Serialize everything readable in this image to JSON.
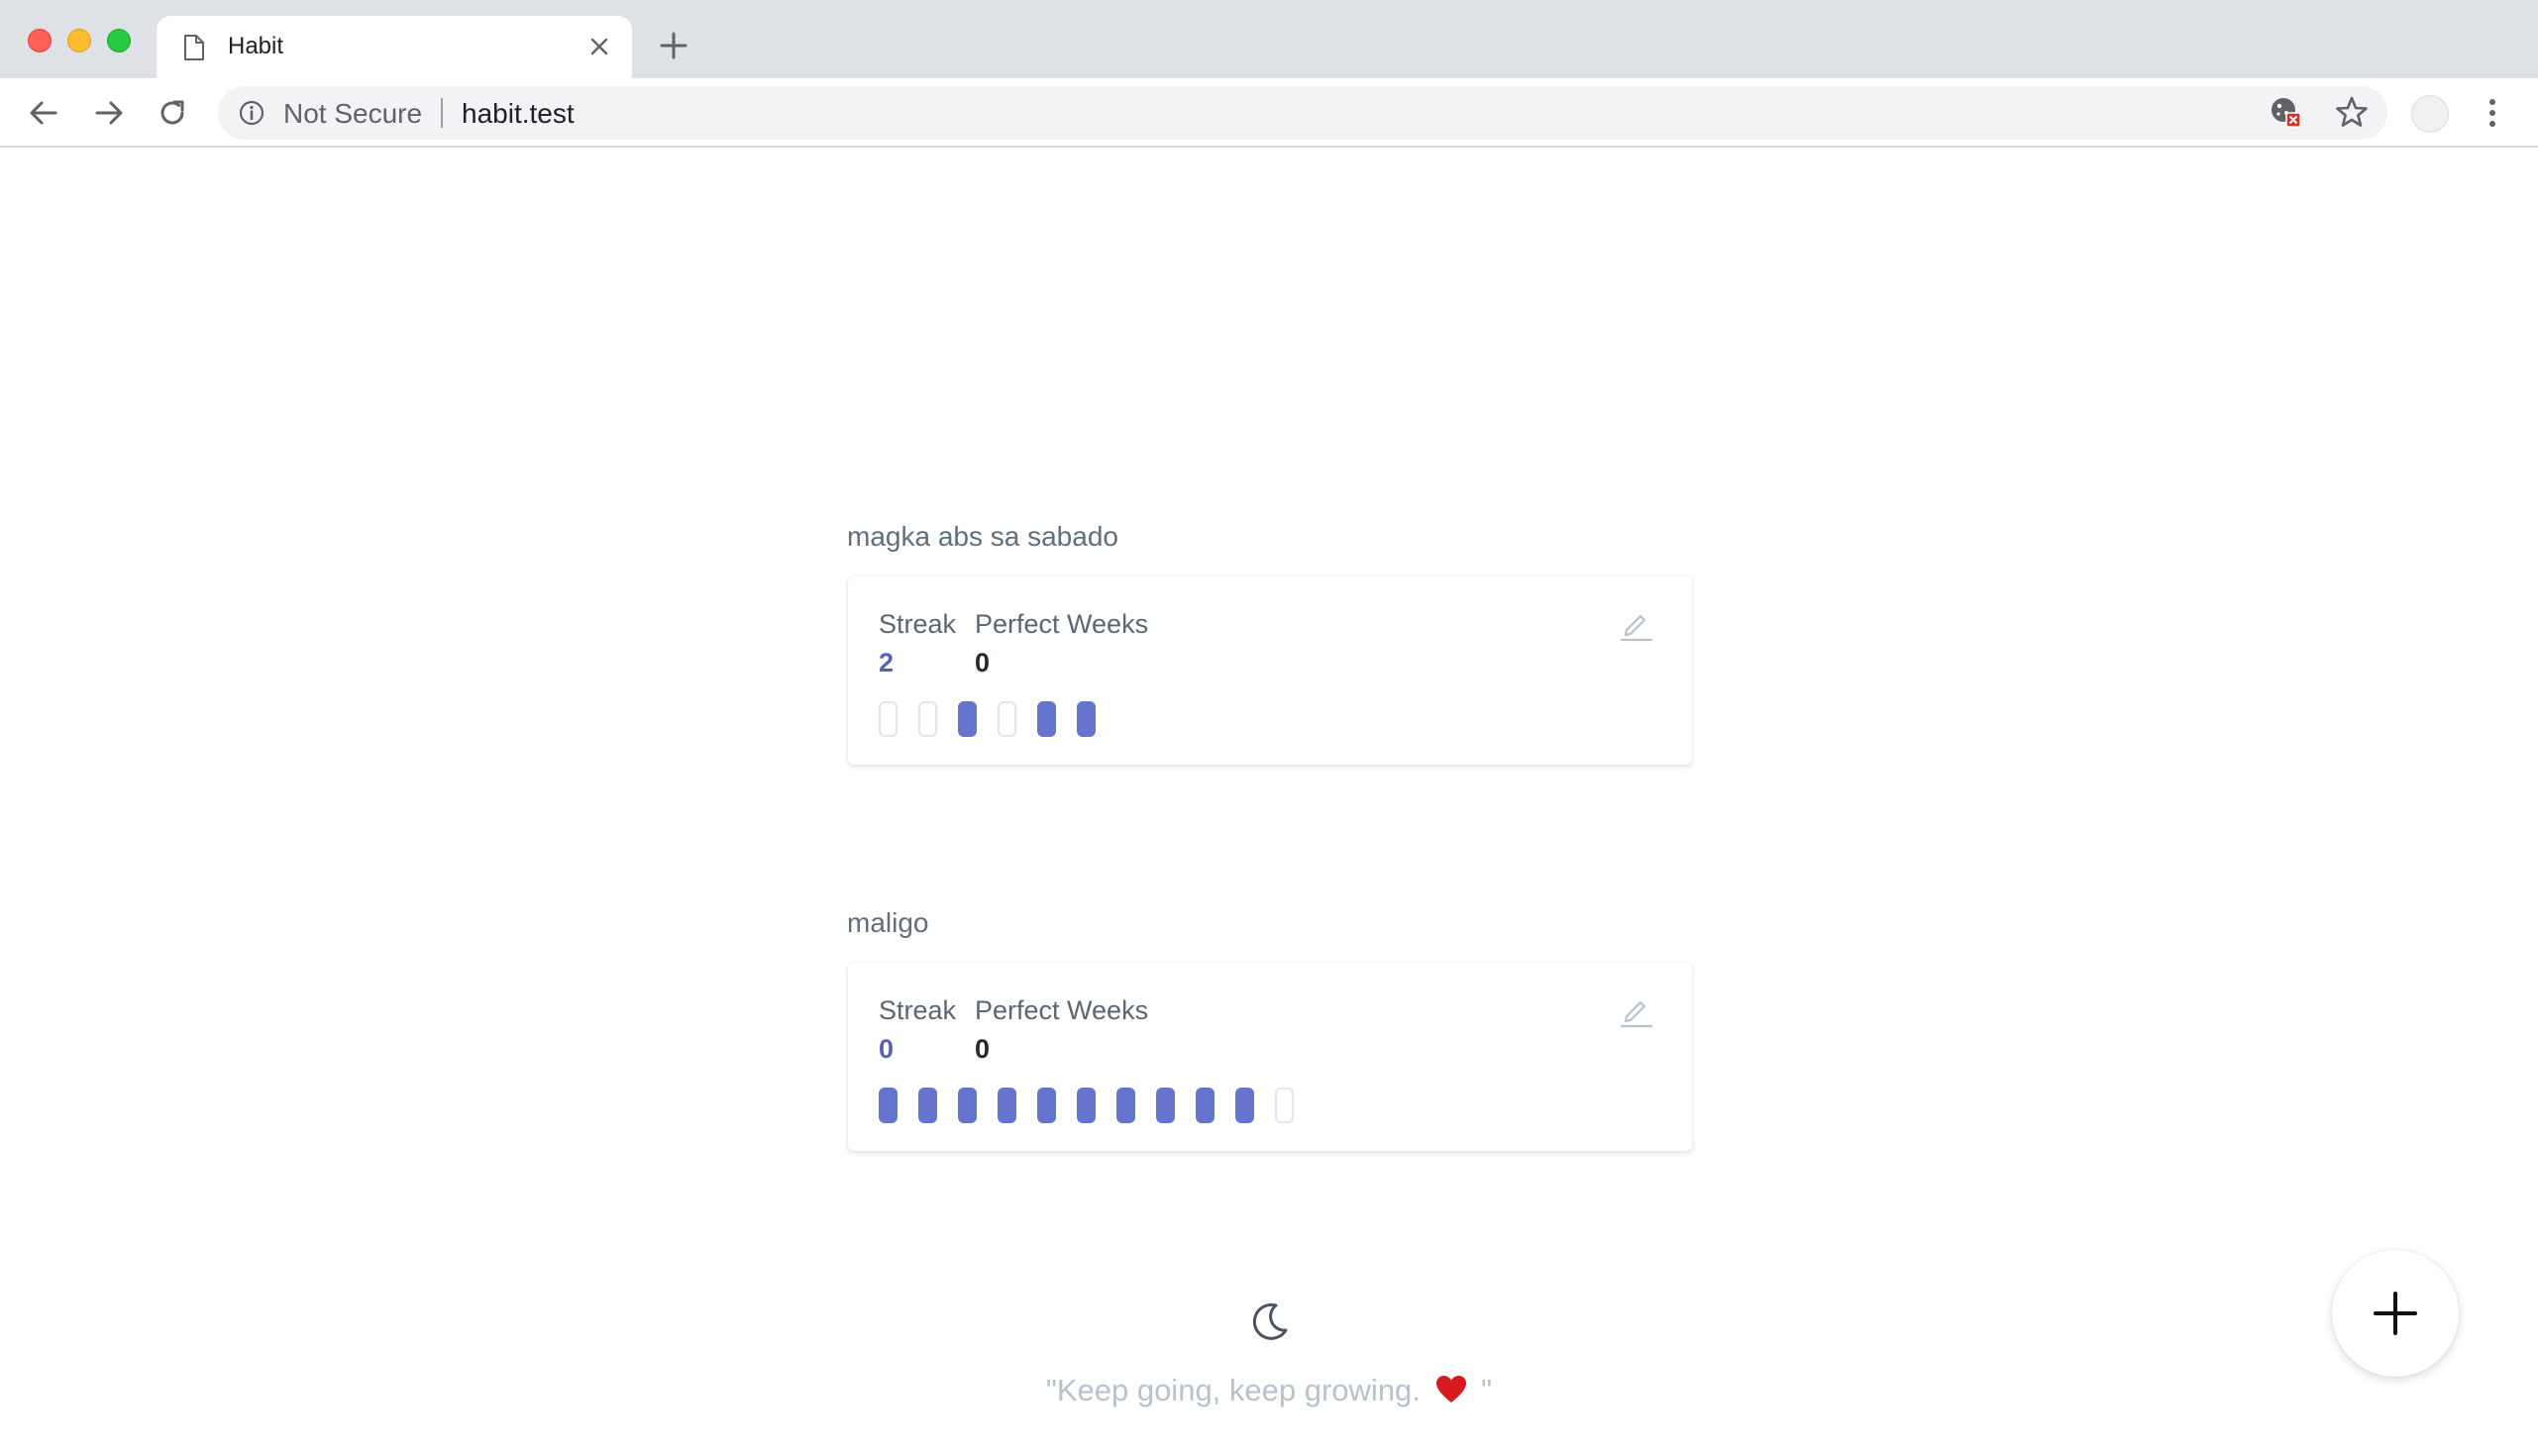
{
  "browser": {
    "tab_title": "Habit",
    "security_label": "Not Secure",
    "url": "habit.test"
  },
  "habits": [
    {
      "name": "magka abs sa sabado",
      "streak_label": "Streak",
      "streak_value": "2",
      "perfect_weeks_label": "Perfect Weeks",
      "perfect_weeks_value": "0",
      "days": [
        false,
        false,
        true,
        false,
        true,
        true
      ]
    },
    {
      "name": "maligo",
      "streak_label": "Streak",
      "streak_value": "0",
      "perfect_weeks_label": "Perfect Weeks",
      "perfect_weeks_value": "0",
      "days": [
        true,
        true,
        true,
        true,
        true,
        true,
        true,
        true,
        true,
        true,
        false
      ]
    }
  ],
  "footer": {
    "quote_before": "\"Keep going, keep growing.",
    "quote_after": "\""
  },
  "colors": {
    "accent": "#6574cd",
    "streak_text": "#5661b3",
    "muted": "#b8c2cc"
  },
  "icons": {
    "theme_toggle": "moon-icon",
    "add": "plus-icon",
    "edit": "pencil-icon"
  }
}
